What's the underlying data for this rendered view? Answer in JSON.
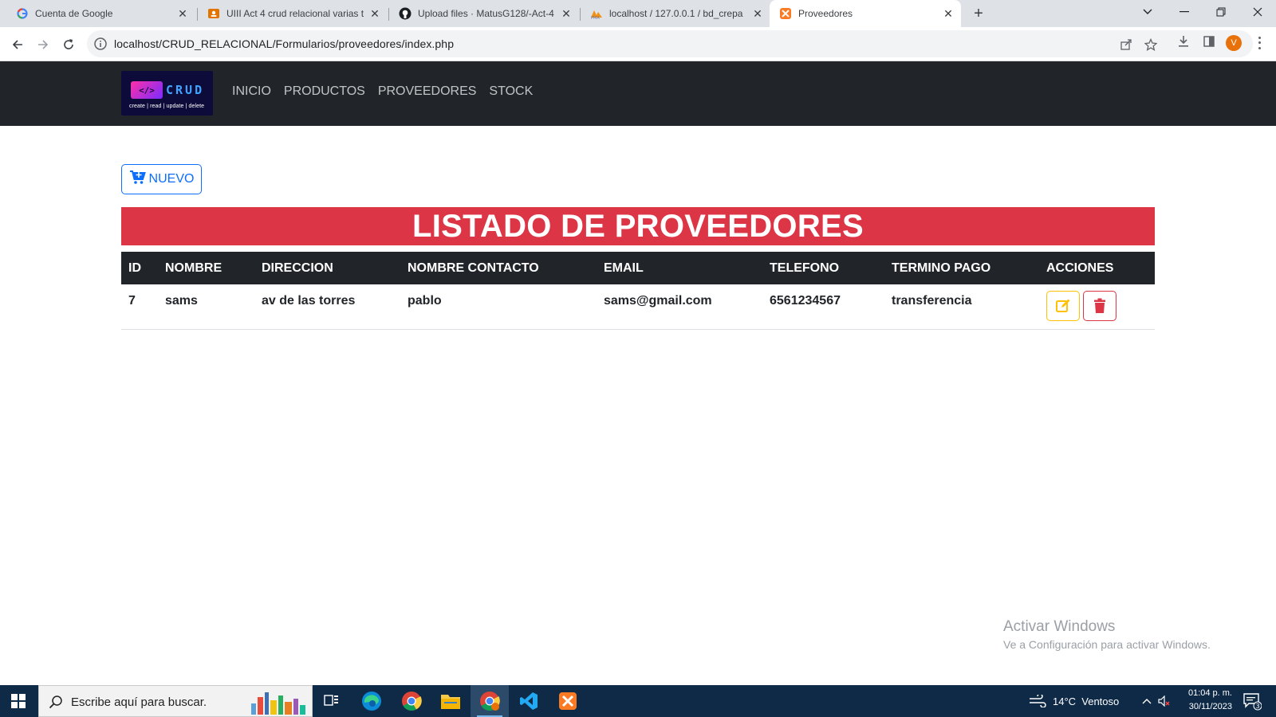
{
  "browser": {
    "tabs": [
      {
        "title": "Cuenta de Google",
        "icon": "google-icon",
        "active": false
      },
      {
        "title": "UIII Act 4 crud relacional varias t",
        "icon": "classroom-icon",
        "active": false
      },
      {
        "title": "Upload files · MatusG128/-Act-4",
        "icon": "github-icon",
        "active": false
      },
      {
        "title": "localhost / 127.0.0.1 / bd_crepa",
        "icon": "phpmyadmin-icon",
        "active": false
      },
      {
        "title": "Proveedores",
        "icon": "xampp-icon",
        "active": true
      }
    ],
    "url": "localhost/CRUD_RELACIONAL/Formularios/proveedores/index.php",
    "profile_initial": "V"
  },
  "navbar": {
    "brand": {
      "code": "</>",
      "word": "CRUD",
      "tagline": "create | read | update | delete"
    },
    "links": [
      "INICIO",
      "PRODUCTOS",
      "PROVEEDORES",
      "STOCK"
    ]
  },
  "content": {
    "new_button": "NUEVO",
    "title": "LISTADO DE PROVEEDORES",
    "table": {
      "headers": [
        "ID",
        "NOMBRE",
        "DIRECCION",
        "NOMBRE CONTACTO",
        "EMAIL",
        "TELEFONO",
        "TERMINO PAGO",
        "ACCIONES"
      ],
      "rows": [
        [
          "7",
          "sams",
          "av de las torres",
          "pablo",
          "sams@gmail.com",
          "6561234567",
          "transferencia"
        ]
      ]
    }
  },
  "watermark": {
    "line1": "Activar Windows",
    "line2": "Ve a Configuración para activar Windows."
  },
  "taskbar": {
    "search_placeholder": "Escribe aquí para buscar.",
    "weather": "14°C  Ventoso",
    "time": "01:04 p. m.",
    "date": "30/11/2023",
    "notifications": "3"
  },
  "colors": {
    "navbar": "#212529",
    "banner": "#dc3545",
    "primary": "#0d6efd",
    "warning": "#ffc107",
    "taskbar": "#0e2a47"
  }
}
